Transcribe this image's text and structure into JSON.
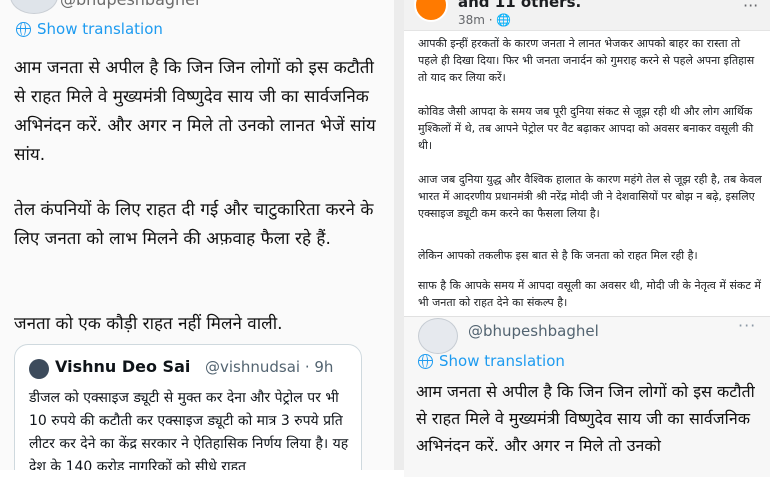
{
  "left_tweet": {
    "handle": "@bhupeshbaghel",
    "show_translation": "Show translation",
    "paragraphs": [
      "आम जनता से अपील है कि जिन जिन लोगों को इस कटौती से राहत मिले वे मुख्यमंत्री विष्णुदेव साय जी का सार्वजनिक अभिनंदन करें. और अगर न मिले तो उनको लानत भेजें सांय सांय.",
      "तेल कंपनियों के लिए राहत दी गई और चाटुकारिता करने के लिए जनता को लाभ मिलने की अफ़वाह फैला रहे हैं.",
      "जनता को एक कौड़ी राहत नहीं मिलने वाली."
    ],
    "quote": {
      "name": "Vishnu Deo Sai",
      "handle_time": "@vishnudsai · 9h",
      "text": "डीजल को एक्साइज ड्यूटी से मुक्त कर देना और पेट्रोल पर भी 10 रुपये की कटौती कर एक्साइज ड्यूटी को मात्र 3 रुपये प्रति लीटर कर देने का केंद्र सरकार ने ऐतिहासिक निर्णय लिया है। यह देश के 140 करोड़ नागरिकों को सीधे राहत"
    }
  },
  "right_post": {
    "reacted_text": "and 11 others.",
    "meta": "38m · 🌐",
    "menu": "···",
    "paragraphs": [
      "आपकी इन्हीं हरकतों के कारण जनता ने लानत भेजकर आपको बाहर का रास्ता तो पहले ही दिखा दिया। फिर भी जनता जनार्दन को गुमराह करने से पहले अपना इतिहास तो याद कर लिया करें।",
      "कोविड जैसी आपदा के समय जब पूरी दुनिया संकट से जूझ रही थी और लोग आर्थिक मुश्किलों में थे, तब आपने पेट्रोल पर वैट बढ़ाकर आपदा को अवसर बनाकर वसूली की थी।",
      "आज जब दुनिया युद्ध और वैश्विक हालात के कारण महंगे तेल से जूझ रही है, तब केवल भारत में आदरणीय प्रधानमंत्री श्री नरेंद्र मोदी जी ने देशवासियों पर बोझ न बढ़े, इसलिए एक्साइज ड्यूटी कम करने का फैसला लिया है।",
      "लेकिन आपको तकलीफ इस बात से है कि जनता को राहत मिल रही है।",
      "साफ है कि आपके समय में आपदा वसूली का अवसर थी, मोदी जी के नेतृत्व में संकट में भी जनता को राहत देने का संकल्प है।"
    ],
    "inner_tweet": {
      "handle": "@bhupeshbaghel",
      "menu": "···",
      "show_translation": "Show translation",
      "paragraph": "आम जनता से अपील है कि जिन जिन लोगों को इस कटौती से राहत मिले वे मुख्यमंत्री विष्णुदेव साय जी का सार्वजनिक अभिनंदन करें. और अगर न मिले तो उनको"
    }
  },
  "colors": {
    "link": "#1d9bf0",
    "text": "#111111",
    "muted": "#536471"
  }
}
